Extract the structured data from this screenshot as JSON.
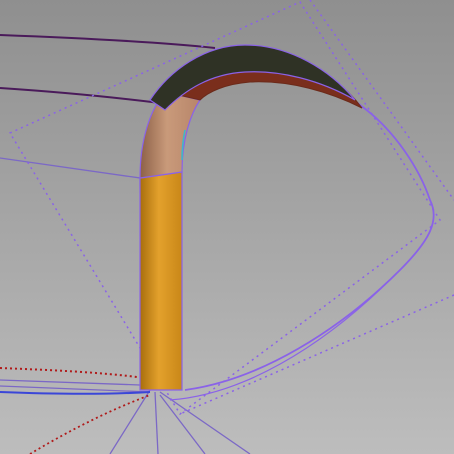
{
  "viewport": {
    "kind": "cad-3d-viewport",
    "background_top": "#8f8f8f",
    "background_bottom": "#bdbdbd"
  },
  "scene": {
    "surfaces": [
      {
        "name": "tube-lower",
        "color": "#e3a12c",
        "shade": "#a86e0d"
      },
      {
        "name": "tube-upper",
        "color": "#c99a7a",
        "shade": "#8d6148"
      },
      {
        "name": "cap-top",
        "color": "#2f3225"
      },
      {
        "name": "cap-rim",
        "color": "#7a2e1c"
      }
    ],
    "curve_colors": {
      "construction": "#8a62e8",
      "frame": "#7b68c6",
      "edge_dark": "#4a1a5a",
      "edge_blue": "#3a46d8",
      "edge_red": "#b01a1a",
      "edge_cyan": "#3fb7c9"
    }
  }
}
